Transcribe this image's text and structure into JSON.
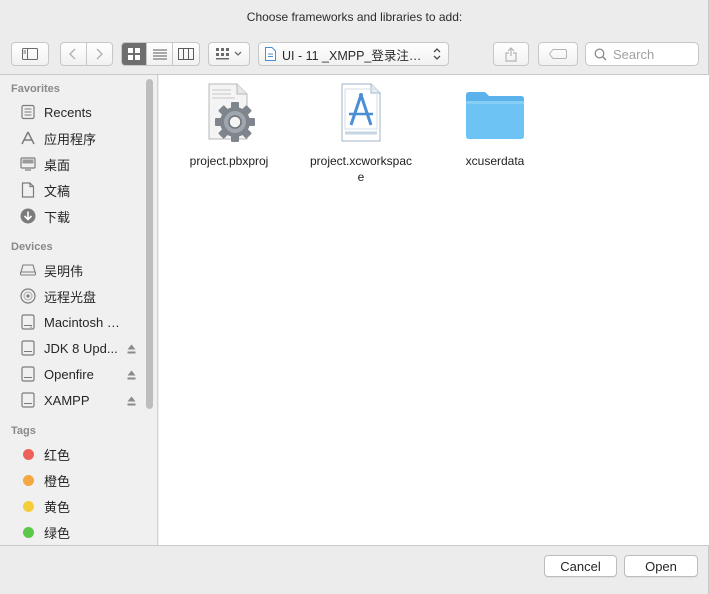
{
  "dialog": {
    "title": "Choose frameworks and libraries to add:"
  },
  "toolbar": {
    "path_label": "UI - 11 _XMPP_登录注册....",
    "search_placeholder": "Search"
  },
  "sidebar": {
    "favorites_heading": "Favorites",
    "favorites": [
      {
        "label": "Recents",
        "icon": "recents-icon"
      },
      {
        "label": "应用程序",
        "icon": "applications-icon"
      },
      {
        "label": "桌面",
        "icon": "desktop-icon"
      },
      {
        "label": "文稿",
        "icon": "documents-icon"
      },
      {
        "label": "下载",
        "icon": "downloads-icon"
      }
    ],
    "devices_heading": "Devices",
    "devices": [
      {
        "label": "吴明伟",
        "icon": "computer-icon"
      },
      {
        "label": "远程光盘",
        "icon": "remote-disc-icon"
      },
      {
        "label": "Macintosh HD",
        "icon": "hard-drive-icon"
      },
      {
        "label": "JDK 8 Upd...",
        "icon": "disk-image-icon",
        "ejectable": true
      },
      {
        "label": "Openfire",
        "icon": "disk-image-icon",
        "ejectable": true
      },
      {
        "label": "XAMPP",
        "icon": "disk-image-icon",
        "ejectable": true
      }
    ],
    "tags_heading": "Tags",
    "tags": [
      {
        "label": "红色",
        "color": "#f0605a"
      },
      {
        "label": "橙色",
        "color": "#f5a742"
      },
      {
        "label": "黄色",
        "color": "#f5cd3a"
      },
      {
        "label": "绿色",
        "color": "#5cc84a"
      }
    ]
  },
  "files": [
    {
      "name": "project.pbxproj",
      "icon": "pbxproj-file-icon"
    },
    {
      "name": "project.xcworkspace",
      "icon": "xcworkspace-file-icon"
    },
    {
      "name": "xcuserdata",
      "icon": "folder-icon"
    }
  ],
  "buttons": {
    "cancel": "Cancel",
    "open": "Open"
  },
  "colors": {
    "folder": "#6ec3f5",
    "selected_segment": "#6e6e6e"
  }
}
